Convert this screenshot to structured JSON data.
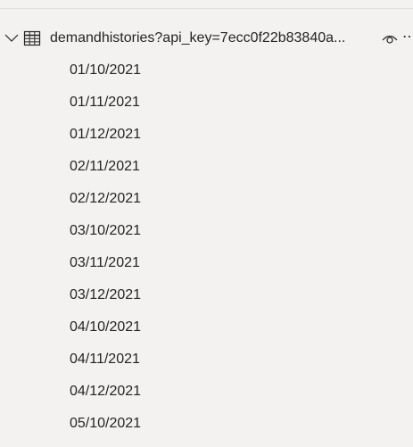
{
  "table": {
    "name": "demandhistories?api_key=7ecc0f22b83840a...",
    "expand_icon": "chevron-down-icon",
    "type_icon": "table-icon",
    "visibility_icon": "eye-icon",
    "more_icon": "more-options-icon",
    "more_label": "⋯"
  },
  "fields": [
    {
      "label": "01/10/2021"
    },
    {
      "label": "01/11/2021"
    },
    {
      "label": "01/12/2021"
    },
    {
      "label": "02/11/2021"
    },
    {
      "label": "02/12/2021"
    },
    {
      "label": "03/10/2021"
    },
    {
      "label": "03/11/2021"
    },
    {
      "label": "03/12/2021"
    },
    {
      "label": "04/10/2021"
    },
    {
      "label": "04/11/2021"
    },
    {
      "label": "04/12/2021"
    },
    {
      "label": "05/10/2021"
    }
  ]
}
